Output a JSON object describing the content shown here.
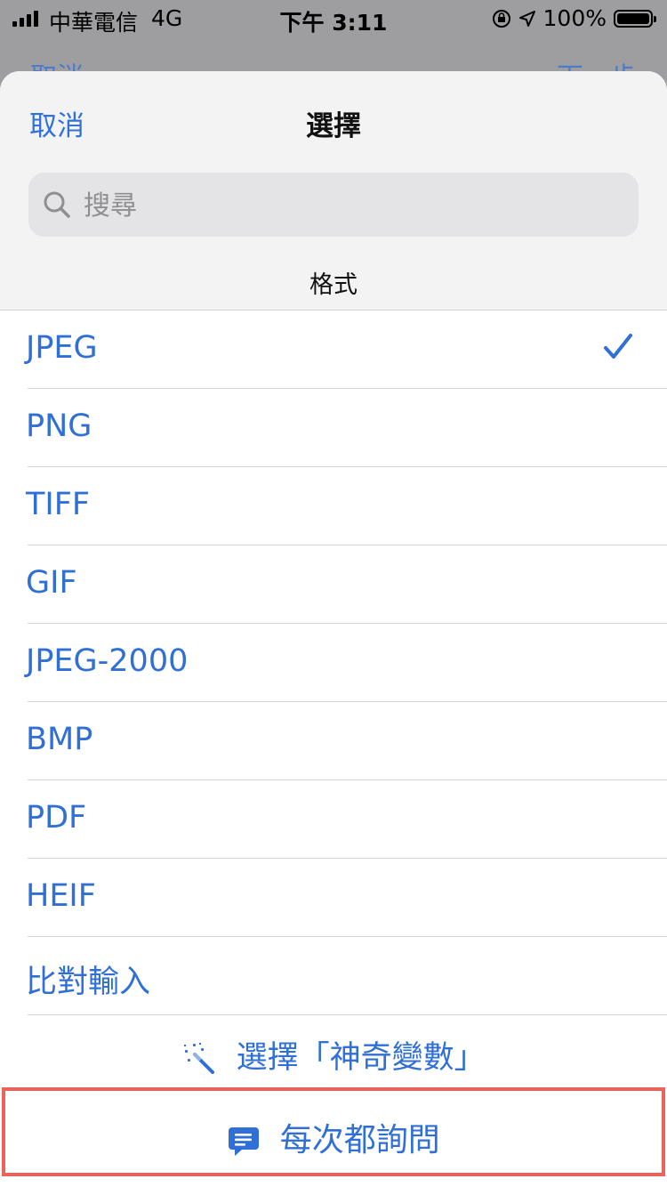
{
  "status_bar": {
    "carrier": "中華電信",
    "network": "4G",
    "time": "下午 3:11",
    "battery": "100%"
  },
  "background_nav": {
    "left_label": "取消",
    "right_label": "下一步"
  },
  "sheet": {
    "cancel_label": "取消",
    "title": "選擇",
    "search_placeholder": "搜尋",
    "section_title": "格式",
    "items": [
      {
        "label": "JPEG",
        "selected": true
      },
      {
        "label": "PNG",
        "selected": false
      },
      {
        "label": "TIFF",
        "selected": false
      },
      {
        "label": "GIF",
        "selected": false
      },
      {
        "label": "JPEG-2000",
        "selected": false
      },
      {
        "label": "BMP",
        "selected": false
      },
      {
        "label": "PDF",
        "selected": false
      },
      {
        "label": "HEIF",
        "selected": false
      },
      {
        "label": "比對輸入",
        "selected": false
      }
    ],
    "magic_variable_label": "選擇「神奇變數」",
    "ask_each_time_label": "每次都詢問"
  },
  "colors": {
    "accent": "#2f6fd6",
    "highlight_border": "#ea6458"
  }
}
